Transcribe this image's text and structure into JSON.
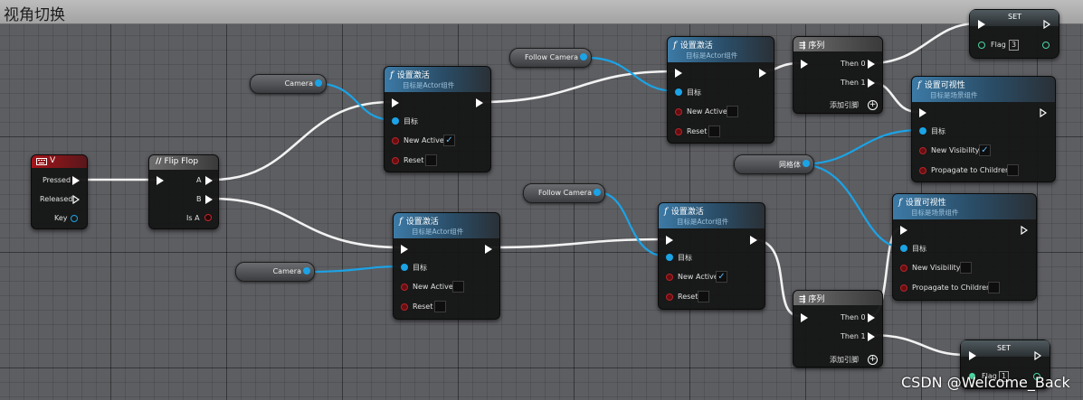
{
  "window": {
    "title": "视角切换"
  },
  "watermark": "CSDN @Welcome_Back",
  "colors": {
    "exec_wire": "#ffffff",
    "object_wire": "#1ba3e6",
    "function_header": "#3c7aa6",
    "event_header": "#a3141a",
    "bool_pin": "#c4262c"
  },
  "event_v": {
    "title": "V",
    "icon": "keyboard-icon",
    "pins": {
      "pressed": "Pressed",
      "released": "Released",
      "key": "Key"
    }
  },
  "flipflop": {
    "title": "Flip Flop",
    "icon": "flipflop-icon",
    "pins": {
      "a": "A",
      "b": "B",
      "is_a": "Is A"
    }
  },
  "var_camera_top": {
    "label": "Camera"
  },
  "var_camera_bottom": {
    "label": "Camera"
  },
  "var_follow_top": {
    "label": "Follow Camera"
  },
  "var_follow_bottom": {
    "label": "Follow Camera"
  },
  "var_mesh": {
    "label": "网格体"
  },
  "act1": {
    "title": "设置激活",
    "subtitle": "目标是Actor组件",
    "target": "目标",
    "new_active": "New Active",
    "new_active_checked": true,
    "reset": "Reset",
    "reset_checked": false
  },
  "act2": {
    "title": "设置激活",
    "subtitle": "目标是Actor组件",
    "target": "目标",
    "new_active": "New Active",
    "new_active_checked": false,
    "reset": "Reset",
    "reset_checked": false
  },
  "act3": {
    "title": "设置激活",
    "subtitle": "目标是Actor组件",
    "target": "目标",
    "new_active": "New Active",
    "new_active_checked": false,
    "reset": "Reset",
    "reset_checked": false
  },
  "act4": {
    "title": "设置激活",
    "subtitle": "目标是Actor组件",
    "target": "目标",
    "new_active": "New Active",
    "new_active_checked": true,
    "reset": "Reset",
    "reset_checked": false
  },
  "seq1": {
    "title": "序列",
    "then0": "Then 0",
    "then1": "Then 1",
    "add_pin": "添加引脚"
  },
  "seq2": {
    "title": "序列",
    "then0": "Then 0",
    "then1": "Then 1",
    "add_pin": "添加引脚"
  },
  "vis1": {
    "title": "设置可视性",
    "subtitle": "目标是场景组件",
    "target": "目标",
    "new_visibility": "New Visibility",
    "new_visibility_checked": true,
    "propagate": "Propagate to Children",
    "propagate_checked": false
  },
  "vis2": {
    "title": "设置可视性",
    "subtitle": "目标是场景组件",
    "target": "目标",
    "new_visibility": "New Visibility",
    "new_visibility_checked": false,
    "propagate": "Propagate to Children",
    "propagate_checked": false
  },
  "set1": {
    "title": "SET",
    "var": "Flag",
    "value": "3"
  },
  "set2": {
    "title": "SET",
    "var": "Flag",
    "value": "1"
  }
}
